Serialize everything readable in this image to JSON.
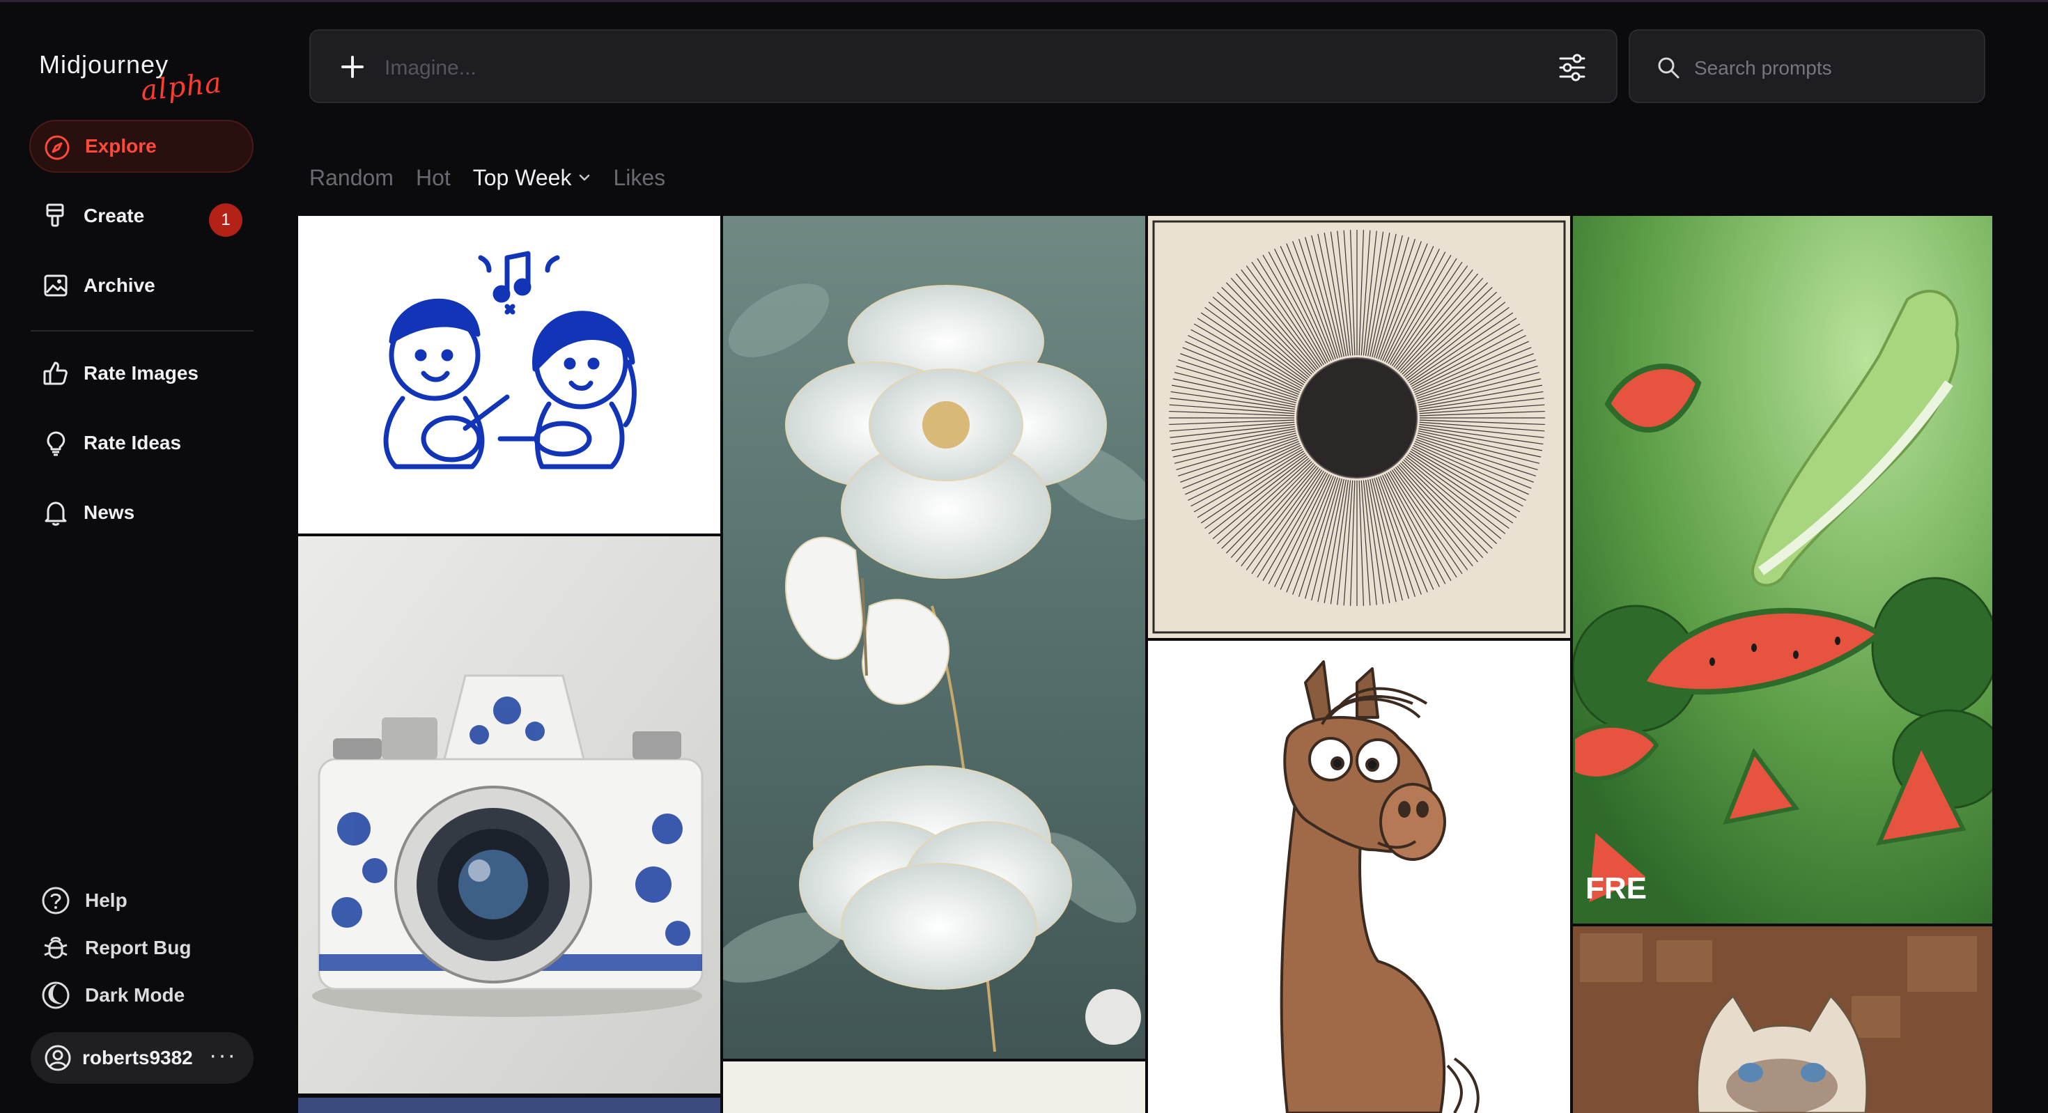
{
  "app": {
    "logo_main": "Midjourney",
    "logo_sub": "alpha",
    "accent_color": "#ff4a3a"
  },
  "sidebar": {
    "items": [
      {
        "label": "Explore",
        "icon": "compass-icon",
        "active": true
      },
      {
        "label": "Create",
        "icon": "paintbrush-icon",
        "badge": "1"
      },
      {
        "label": "Archive",
        "icon": "image-icon"
      },
      {
        "label": "Rate Images",
        "icon": "thumbs-up-icon"
      },
      {
        "label": "Rate Ideas",
        "icon": "lightbulb-icon"
      },
      {
        "label": "News",
        "icon": "bell-icon"
      }
    ],
    "bottom": [
      {
        "label": "Help",
        "icon": "help-circle-icon"
      },
      {
        "label": "Report Bug",
        "icon": "bug-icon"
      },
      {
        "label": "Dark Mode",
        "icon": "moon-icon"
      }
    ],
    "user": {
      "name": "roberts9382",
      "more": "···"
    }
  },
  "topbar": {
    "imagine_placeholder": "Imagine...",
    "search_placeholder": "Search prompts"
  },
  "tabs": [
    {
      "label": "Random",
      "active": false
    },
    {
      "label": "Hot",
      "active": false
    },
    {
      "label": "Top Week",
      "active": true,
      "dropdown": true
    },
    {
      "label": "Likes",
      "active": false
    }
  ],
  "gallery": {
    "images": [
      {
        "subject": "blue line art kids playing guitar"
      },
      {
        "subject": "blue and white porcelain camera"
      },
      {
        "subject": "white peony and butterfly"
      },
      {
        "subject": "radiating lines sun"
      },
      {
        "subject": "cartoon horse"
      },
      {
        "subject": "watermelon sneaker"
      },
      {
        "subject": "grumpy cat"
      }
    ],
    "watermelon_caption": "FRE"
  }
}
